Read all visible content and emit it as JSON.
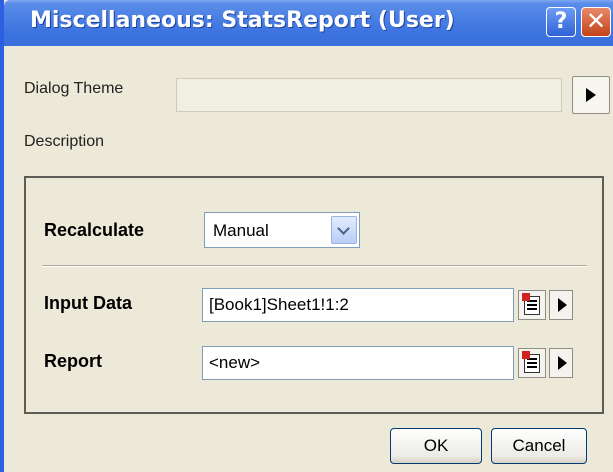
{
  "window": {
    "title": "Miscellaneous: StatsReport (User)",
    "help_label": "?",
    "close_label": "✕"
  },
  "dialog_theme": {
    "label": "Dialog Theme",
    "value": "",
    "arrow_icon": "right-triangle-icon"
  },
  "description": {
    "label": "Description"
  },
  "settings": {
    "recalculate": {
      "label": "Recalculate",
      "value": "Manual"
    },
    "input_data": {
      "label": "Input Data",
      "value": "[Book1]Sheet1!1:2"
    },
    "report": {
      "label": "Report",
      "value": "<new>"
    }
  },
  "buttons": {
    "ok": "OK",
    "cancel": "Cancel"
  },
  "colors": {
    "titlebar": "#3d74df",
    "dialog_bg": "#ece9d8",
    "close_button": "#c4421a"
  }
}
